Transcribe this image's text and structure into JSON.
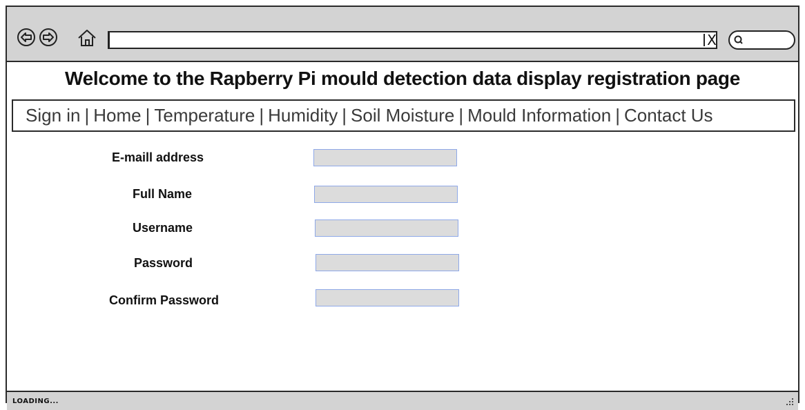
{
  "page": {
    "title": "Welcome to the Rapberry Pi mould detection data display registration page"
  },
  "browser": {
    "address_value": "",
    "clear_label": "X",
    "search_value": "",
    "icons": [
      "back-icon",
      "forward-icon",
      "home-icon",
      "search-icon"
    ]
  },
  "nav": {
    "items": [
      {
        "label": "Sign in"
      },
      {
        "label": "Home"
      },
      {
        "label": "Temperature"
      },
      {
        "label": "Humidity"
      },
      {
        "label": "Soil Moisture"
      },
      {
        "label": "Mould Information"
      },
      {
        "label": "Contact Us"
      }
    ],
    "separator": "|"
  },
  "form": {
    "fields": [
      {
        "label": "E-maill address",
        "value": ""
      },
      {
        "label": "Full Name",
        "value": ""
      },
      {
        "label": "Username",
        "value": ""
      },
      {
        "label": "Password",
        "value": ""
      },
      {
        "label": "Confirm Password",
        "value": ""
      }
    ]
  },
  "status": {
    "text": "LOADING..."
  },
  "colors": {
    "chrome_gray": "#d3d3d3",
    "field_fill": "#dcdcdc",
    "field_border": "#8ea8e8"
  }
}
